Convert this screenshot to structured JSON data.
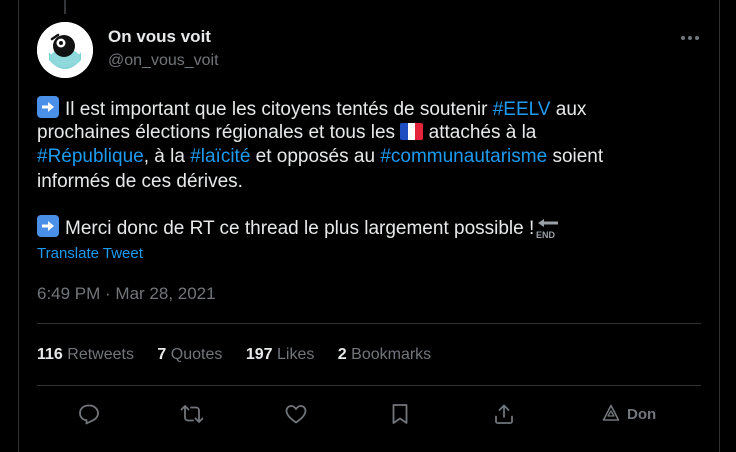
{
  "author": {
    "name": "On vous voit",
    "handle": "@on_vous_voit"
  },
  "tweet": {
    "line1_pre": "Il est important que les citoyens tentés de soutenir ",
    "line1_tag": "#EELV",
    "line1_post": " aux",
    "line2_pre": "prochaines élections régionales et tous les ",
    "line2_post": " attachés à la",
    "line3_tag1": "#République",
    "line3_mid1": ", à la ",
    "line3_tag2": "#laïcité",
    "line3_mid2": " et opposés au ",
    "line3_tag3": "#communautarisme",
    "line3_post": " soient",
    "line4": "informés de ces dérives.",
    "line5": "Merci donc de RT ce thread le plus largement possible !",
    "end_icon_text": "END"
  },
  "translate_label": "Translate Tweet",
  "timestamp": "6:49 PM · Mar 28, 2021",
  "stats": {
    "retweets_count": "116",
    "retweets_label": "Retweets",
    "quotes_count": "7",
    "quotes_label": "Quotes",
    "likes_count": "197",
    "likes_label": "Likes",
    "bookmarks_count": "2",
    "bookmarks_label": "Bookmarks"
  },
  "actions": {
    "don_label": "Don",
    "icons": [
      "reply-icon",
      "retweet-icon",
      "like-icon",
      "bookmark-icon",
      "share-icon",
      "donate-icon"
    ]
  },
  "colors": {
    "background": "#000000",
    "text": "#e7e9ea",
    "muted": "#71767b",
    "link": "#1d9bf0",
    "border": "#2f3336"
  }
}
